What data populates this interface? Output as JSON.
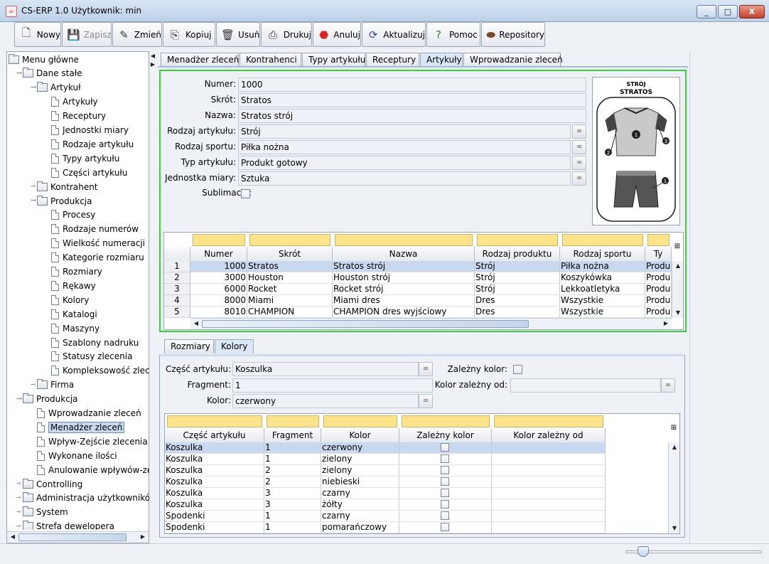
{
  "window": {
    "title": "CS-ERP 1.0  Użytkownik: min",
    "minimize": "_",
    "maximize": "□",
    "close": "X"
  },
  "toolbar": [
    {
      "label": "Nowy",
      "icon": "new-document-icon",
      "enabled": true
    },
    {
      "label": "Zapisz",
      "icon": "save-icon",
      "enabled": false
    },
    {
      "label": "Zmień",
      "icon": "pencil-edit-icon",
      "enabled": true
    },
    {
      "label": "Kopiuj",
      "icon": "copy-icon",
      "enabled": true
    },
    {
      "label": "Usuń",
      "icon": "trash-icon",
      "enabled": true
    },
    {
      "label": "Drukuj",
      "icon": "printer-icon",
      "enabled": true
    },
    {
      "label": "Anuluj",
      "icon": "stop-icon",
      "enabled": true
    },
    {
      "label": "Aktualizuj",
      "icon": "refresh-icon",
      "enabled": true
    },
    {
      "label": "Pomoc",
      "icon": "help-icon",
      "enabled": true
    },
    {
      "label": "Repository",
      "icon": "repository-icon",
      "enabled": true
    }
  ],
  "tree": [
    {
      "label": "Menu główne",
      "level": 0,
      "type": "folder",
      "toggle": ""
    },
    {
      "label": "Dane stałe",
      "level": 1,
      "type": "folder",
      "toggle": "open"
    },
    {
      "label": "Artykuł",
      "level": 2,
      "type": "folder",
      "toggle": "open"
    },
    {
      "label": "Artykuły",
      "level": 3,
      "type": "doc"
    },
    {
      "label": "Receptury",
      "level": 3,
      "type": "doc"
    },
    {
      "label": "Jednostki miary",
      "level": 3,
      "type": "doc"
    },
    {
      "label": "Rodzaje artykułu",
      "level": 3,
      "type": "doc"
    },
    {
      "label": "Typy artykułu",
      "level": 3,
      "type": "doc"
    },
    {
      "label": "Części artykułu",
      "level": 3,
      "type": "doc"
    },
    {
      "label": "Kontrahent",
      "level": 2,
      "type": "folder",
      "toggle": "closed"
    },
    {
      "label": "Produkcja",
      "level": 2,
      "type": "folder",
      "toggle": "open"
    },
    {
      "label": "Procesy",
      "level": 3,
      "type": "doc"
    },
    {
      "label": "Rodzaje numerów",
      "level": 3,
      "type": "doc"
    },
    {
      "label": "Wielkość numeracji",
      "level": 3,
      "type": "doc"
    },
    {
      "label": "Kategorie rozmiaru",
      "level": 3,
      "type": "doc"
    },
    {
      "label": "Rozmiary",
      "level": 3,
      "type": "doc"
    },
    {
      "label": "Rękawy",
      "level": 3,
      "type": "doc"
    },
    {
      "label": "Kolory",
      "level": 3,
      "type": "doc"
    },
    {
      "label": "Katalogi",
      "level": 3,
      "type": "doc"
    },
    {
      "label": "Maszyny",
      "level": 3,
      "type": "doc"
    },
    {
      "label": "Szablony nadruku",
      "level": 3,
      "type": "doc"
    },
    {
      "label": "Statusy zlecenia",
      "level": 3,
      "type": "doc"
    },
    {
      "label": "Kompleksowość zlece",
      "level": 3,
      "type": "doc"
    },
    {
      "label": "Firma",
      "level": 2,
      "type": "folder",
      "toggle": "closed"
    },
    {
      "label": "Produkcja",
      "level": 1,
      "type": "folder",
      "toggle": "open"
    },
    {
      "label": "Wprowadzanie zleceń",
      "level": 2,
      "type": "doc"
    },
    {
      "label": "Menadżer zleceń",
      "level": 2,
      "type": "doc",
      "selected": true
    },
    {
      "label": "Wpływ-Zejście zlecenia",
      "level": 2,
      "type": "doc"
    },
    {
      "label": "Wykonane ilości",
      "level": 2,
      "type": "doc"
    },
    {
      "label": "Anulowanie wpływów-zejś",
      "level": 2,
      "type": "doc"
    },
    {
      "label": "Controlling",
      "level": 1,
      "type": "folder",
      "toggle": "closed"
    },
    {
      "label": "Administracja użytkowników",
      "level": 1,
      "type": "folder",
      "toggle": "closed"
    },
    {
      "label": "System",
      "level": 1,
      "type": "folder",
      "toggle": "closed"
    },
    {
      "label": "Strefa dewelopera",
      "level": 1,
      "type": "folder",
      "toggle": "closed"
    }
  ],
  "tabs": [
    {
      "label": "Menadżer zleceń",
      "active": false
    },
    {
      "label": "Kontrahenci",
      "active": false
    },
    {
      "label": "Typy artykułu",
      "active": false
    },
    {
      "label": "Receptury",
      "active": false
    },
    {
      "label": "Artykuły",
      "active": true
    },
    {
      "label": "Wprowadzanie zleceń",
      "active": false
    }
  ],
  "form": [
    {
      "label": "Numer:",
      "value": "1000",
      "lookup": false
    },
    {
      "label": "Skrót:",
      "value": "Stratos",
      "lookup": false
    },
    {
      "label": "Nazwa:",
      "value": "Stratos strój",
      "lookup": false
    },
    {
      "label": "Rodzaj artykułu:",
      "value": "Strój",
      "lookup": true
    },
    {
      "label": "Rodzaj sportu:",
      "value": "Piłka nożna",
      "lookup": true
    },
    {
      "label": "Typ artykułu:",
      "value": "Produkt gotowy",
      "lookup": true
    },
    {
      "label": "Jednostka miary:",
      "value": "Sztuka",
      "lookup": true
    }
  ],
  "sublimacja": {
    "label": "Sublimacja:",
    "checked": false
  },
  "image": {
    "title1": "STRÓJ",
    "title2": "STRATOS",
    "m1": "1",
    "m2": "2",
    "m3": "3",
    "m4": "1"
  },
  "articles_table": {
    "columns": [
      "Numer",
      "Skrót",
      "Nazwa",
      "Rodzaj produktu",
      "Rodzaj sportu",
      "Ty"
    ],
    "rows": [
      {
        "n": "1",
        "cells": [
          "1000",
          "Stratos",
          "Stratos strój",
          "Strój",
          "Piłka nożna",
          "Produk"
        ]
      },
      {
        "n": "2",
        "cells": [
          "3000",
          "Houston",
          "Houston strój",
          "Strój",
          "Koszykówka",
          "Produk"
        ]
      },
      {
        "n": "3",
        "cells": [
          "6000",
          "Rocket",
          "Rocket strój",
          "Strój",
          "Lekkoatletyka",
          "Produk"
        ]
      },
      {
        "n": "4",
        "cells": [
          "8000",
          "Miami",
          "Miami dres",
          "Dres",
          "Wszystkie",
          "Produk"
        ]
      },
      {
        "n": "5",
        "cells": [
          "8010",
          "CHAMPION",
          "CHAMPION dres wyjściowy",
          "Dres",
          "Wszystkie",
          "Produk"
        ]
      }
    ]
  },
  "subtabs": [
    {
      "label": "Rozmiary",
      "active": false
    },
    {
      "label": "Kolory",
      "active": true
    }
  ],
  "colorform": {
    "part_label": "Część artykułu:",
    "part_value": "Koszulka",
    "fragment_label": "Fragment:",
    "fragment_value": "1",
    "color_label": "Kolor:",
    "color_value": "czerwony",
    "dep_label": "Zależny kolor:",
    "dep_checked": false,
    "depcolor_label": "Kolor zależny od:",
    "depcolor_value": ""
  },
  "colors_table": {
    "columns": [
      "Część artykułu",
      "Fragment",
      "Kolor",
      "Zależny kolor",
      "Kolor zależny od"
    ],
    "rows": [
      [
        "Koszulka",
        "1",
        "czerwony",
        "",
        ""
      ],
      [
        "Koszulka",
        "1",
        "zielony",
        "",
        ""
      ],
      [
        "Koszulka",
        "2",
        "zielony",
        "",
        ""
      ],
      [
        "Koszulka",
        "2",
        "niebieski",
        "",
        ""
      ],
      [
        "Koszulka",
        "3",
        "czarny",
        "",
        ""
      ],
      [
        "Koszulka",
        "3",
        "żółty",
        "",
        ""
      ],
      [
        "Spodenki",
        "1",
        "czarny",
        "",
        ""
      ],
      [
        "Spodenki",
        "1",
        "pomarańczowy",
        "",
        ""
      ]
    ]
  },
  "colors": {
    "accent_green": "#34d234",
    "filter_yellow": "#fde48a",
    "selection": "#c8d8ee"
  }
}
